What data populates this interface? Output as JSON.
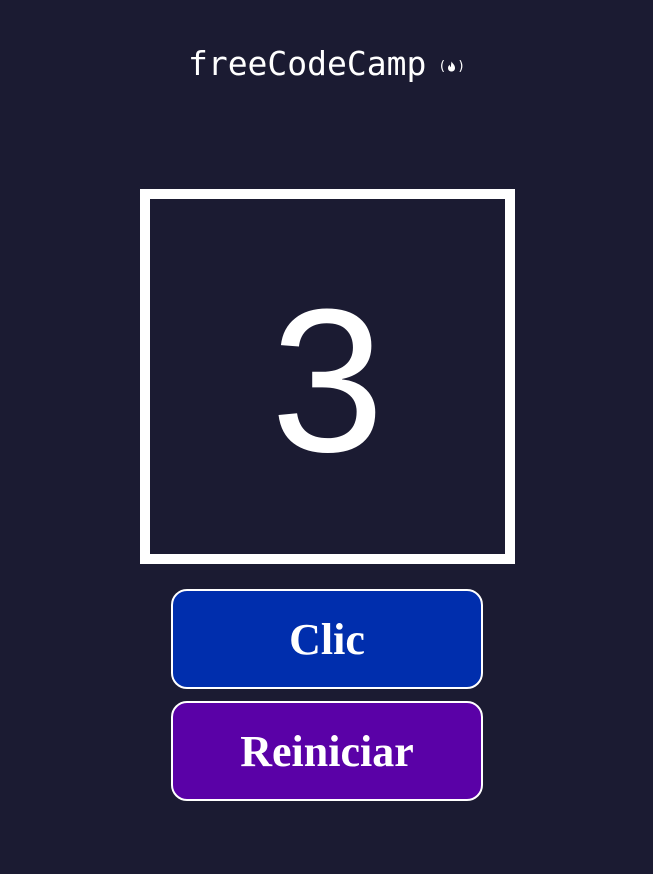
{
  "logo": {
    "text": "freeCodeCamp",
    "icon": "flame-icon",
    "open_paren": "(",
    "close_paren": ")"
  },
  "counter": {
    "value": "3"
  },
  "buttons": {
    "click_label": "Clic",
    "reset_label": "Reiniciar"
  },
  "colors": {
    "background": "#1b1b32",
    "click_button": "#002ead",
    "reset_button": "#5a01a7",
    "foreground": "#ffffff"
  }
}
